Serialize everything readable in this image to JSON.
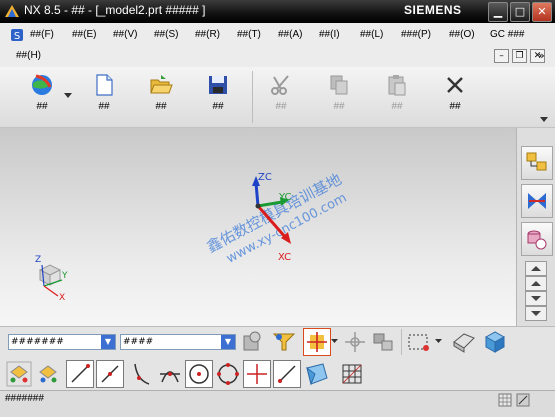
{
  "window": {
    "title": "NX 8.5 - ## - [_model2.prt ##### ]",
    "brand": "SIEMENS",
    "minimize": "▁",
    "maximize": "□",
    "close": "✕"
  },
  "menu": {
    "items": [
      "##(F)",
      "##(E)",
      "##(V)",
      "##(S)",
      "##(R)",
      "##(T)",
      "##(A)",
      "##(I)",
      "##(L)",
      "###(P)",
      "##(O)",
      "GC ###",
      "##(H)"
    ]
  },
  "mdi": {
    "minimize": "–",
    "restore": "❐",
    "close": "✕"
  },
  "toolbar": {
    "items": [
      {
        "label": "##",
        "icon": "start-globe-icon"
      },
      {
        "label": "##",
        "icon": "new-file-icon"
      },
      {
        "label": "##",
        "icon": "open-folder-icon"
      },
      {
        "label": "##",
        "icon": "save-disk-icon"
      },
      {
        "label": "##",
        "icon": "cut-scissors-icon"
      },
      {
        "label": "##",
        "icon": "copy-icon"
      },
      {
        "label": "##",
        "icon": "paste-icon"
      },
      {
        "label": "##",
        "icon": "delete-x-icon"
      }
    ],
    "overflow": "»"
  },
  "graphics": {
    "axes": {
      "z": "ZC",
      "y": "YC",
      "x": "XC"
    },
    "triad": {
      "z": "Z",
      "y": "Y",
      "x": "X"
    },
    "watermark": {
      "line1": "鑫佑数控模具培训基地",
      "line2": "www.xy-cnc100.com"
    },
    "colors": {
      "x": "#d91c1c",
      "y": "#1a9a33",
      "z": "#1f43c8",
      "watermark": "#3c7bd8"
    }
  },
  "bottom": {
    "filter1": "#######",
    "filter2": "####"
  },
  "status": {
    "message": "#######"
  }
}
